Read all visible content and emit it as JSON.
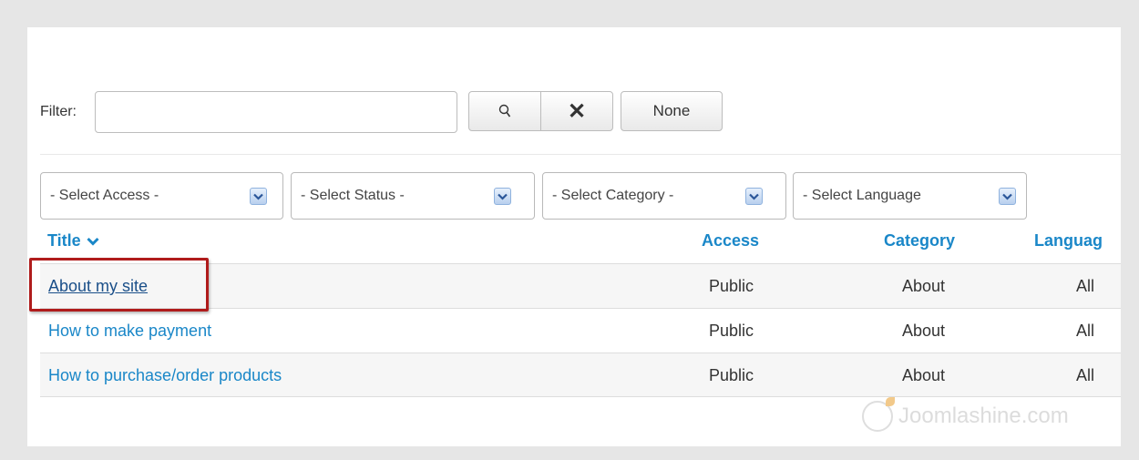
{
  "filter": {
    "label": "Filter:",
    "value": "",
    "placeholder": "",
    "search_icon": "search-icon",
    "clear_icon": "close-icon",
    "clear_symbol": "✕",
    "none_label": "None"
  },
  "selects": {
    "access": "- Select Access -",
    "status": "- Select Status -",
    "category": "- Select Category -",
    "language": "- Select Language"
  },
  "table": {
    "headers": {
      "title": "Title",
      "access": "Access",
      "category": "Category",
      "language": "Languag"
    },
    "rows": [
      {
        "title": "About my site",
        "access": "Public",
        "category": "About",
        "language": "All"
      },
      {
        "title": "How to make payment",
        "access": "Public",
        "category": "About",
        "language": "All"
      },
      {
        "title": "How to purchase/order products",
        "access": "Public",
        "category": "About",
        "language": "All"
      }
    ]
  },
  "watermark": "Joomlashine.com",
  "colors": {
    "link": "#1a87c8",
    "highlight": "#b01c1c"
  }
}
